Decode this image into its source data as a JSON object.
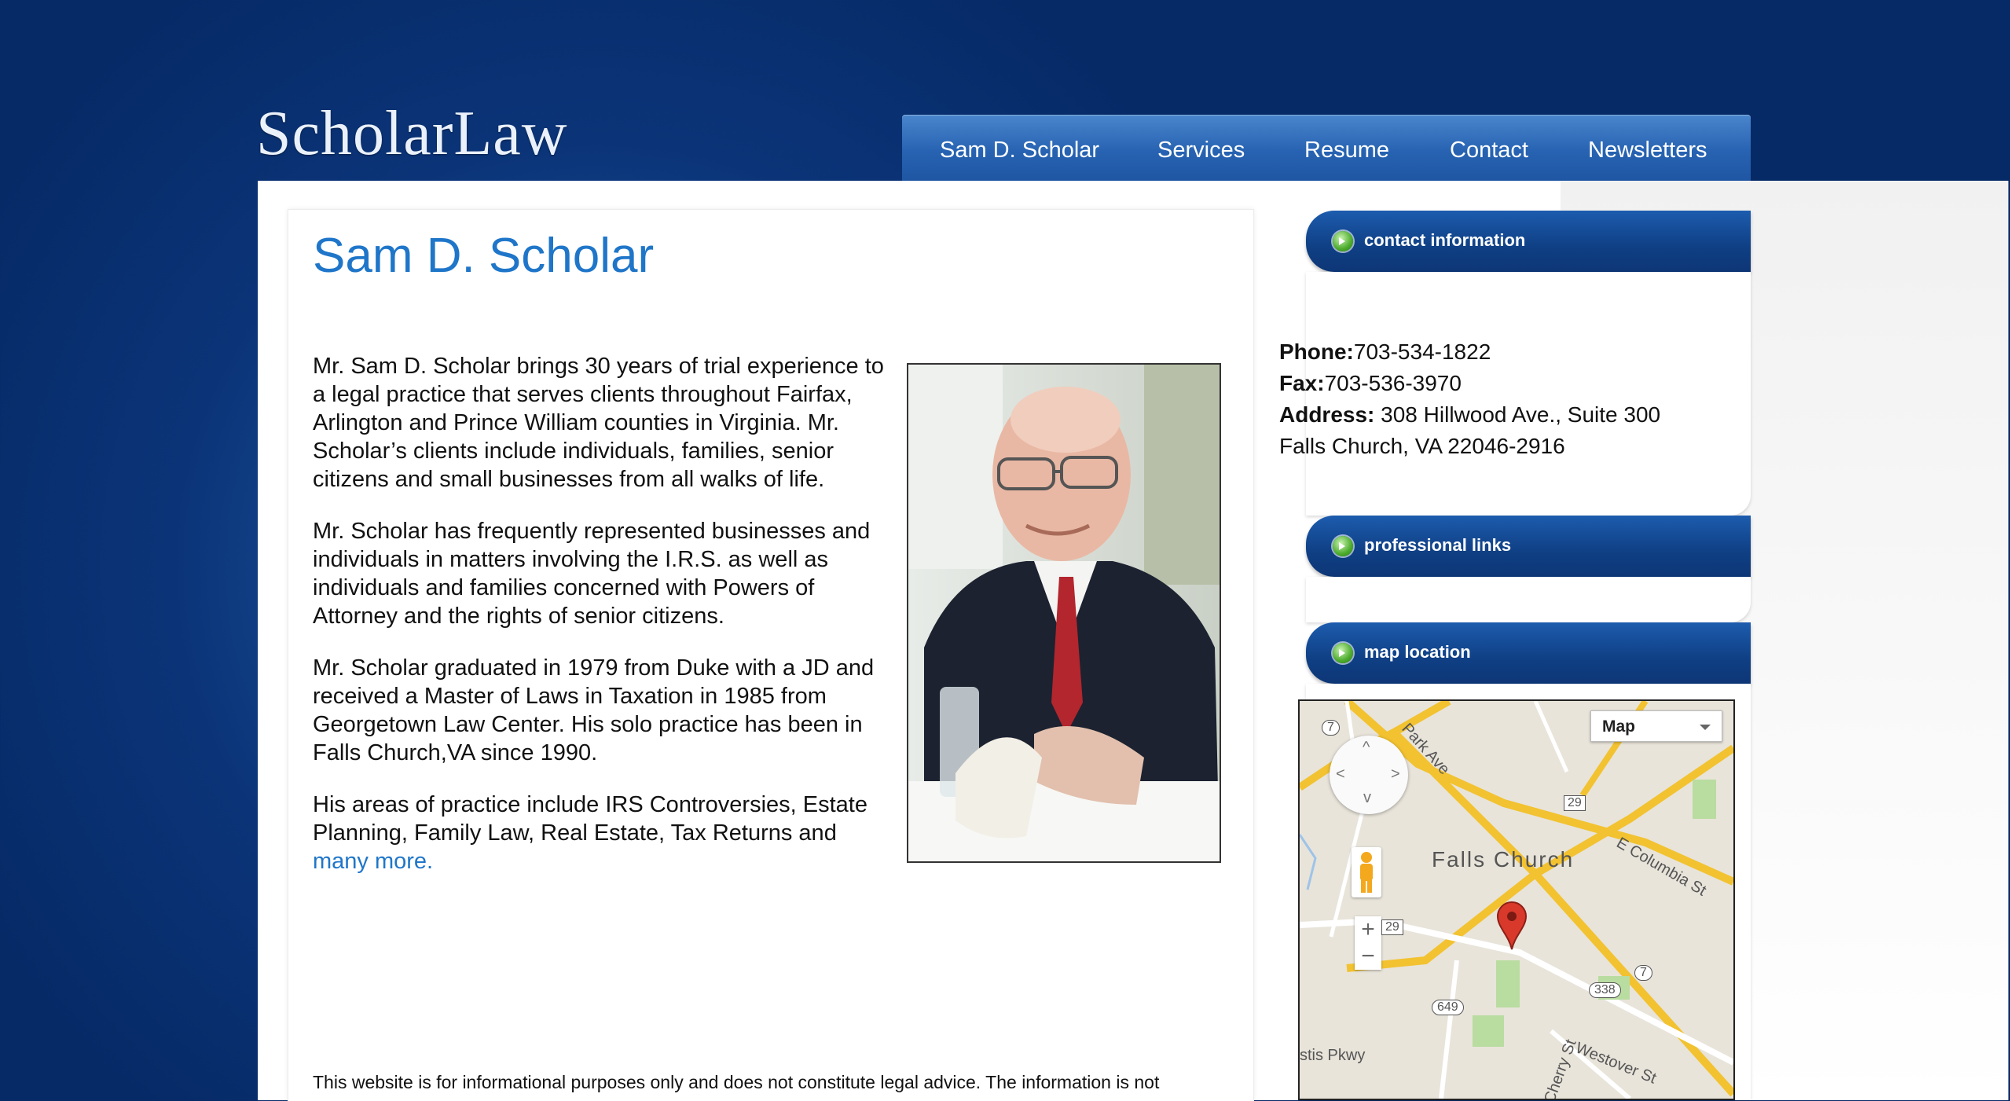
{
  "brand": {
    "logo": "ScholarLaw"
  },
  "nav": {
    "items": [
      "Sam D. Scholar",
      "Services",
      "Resume",
      "Contact",
      "Newsletters"
    ]
  },
  "main": {
    "title": "Sam D. Scholar",
    "paragraphs": [
      "Mr. Sam D. Scholar brings 30 years of trial experience to a legal practice that serves clients throughout Fairfax, Arlington and Prince William counties in Virginia. Mr. Scholar’s clients include individuals, families, senior citizens and small businesses from all walks of life.",
      "Mr. Scholar has frequently represented businesses and individuals in matters involving the I.R.S. as well as individuals and families concerned with Powers of Attorney and the rights of senior citizens.",
      "Mr. Scholar graduated in 1979 from Duke with a JD and received a Master of Laws in Taxation in 1985 from Georgetown Law Center. His solo practice has been in Falls Church,VA since 1990.",
      "His areas of practice include IRS Controversies, Estate Planning, Family Law, Real Estate, Tax Returns and"
    ],
    "more_link": "many more.",
    "disclaimer": "This website is for informational purposes only and does not constitute legal advice. The information is not"
  },
  "sidebar": {
    "contact_tab": "contact information",
    "phone_label": "Phone:",
    "phone": "703-534-1822",
    "fax_label": "Fax:",
    "fax": "703-536-3970",
    "address_label": "Address:",
    "address_line1": " 308 Hillwood Ave., Suite 300",
    "address_line2": "Falls Church, VA 22046-2916",
    "links_tab": "professional links",
    "map_tab": "map location"
  },
  "map": {
    "type_select": "Map",
    "city": "Falls Church",
    "roads": [
      "Park Ave",
      "E Columbia St",
      "Westover St",
      "Cherry St",
      "stis Pkwy"
    ],
    "shields": [
      "7",
      "29",
      "338",
      "649",
      "7",
      "29"
    ],
    "zoom_in": "+",
    "zoom_out": "−"
  },
  "colors": {
    "accent": "#1f76c9",
    "nav": "#2763b2",
    "tab": "#0f3f84",
    "marker": "#d9392b"
  }
}
